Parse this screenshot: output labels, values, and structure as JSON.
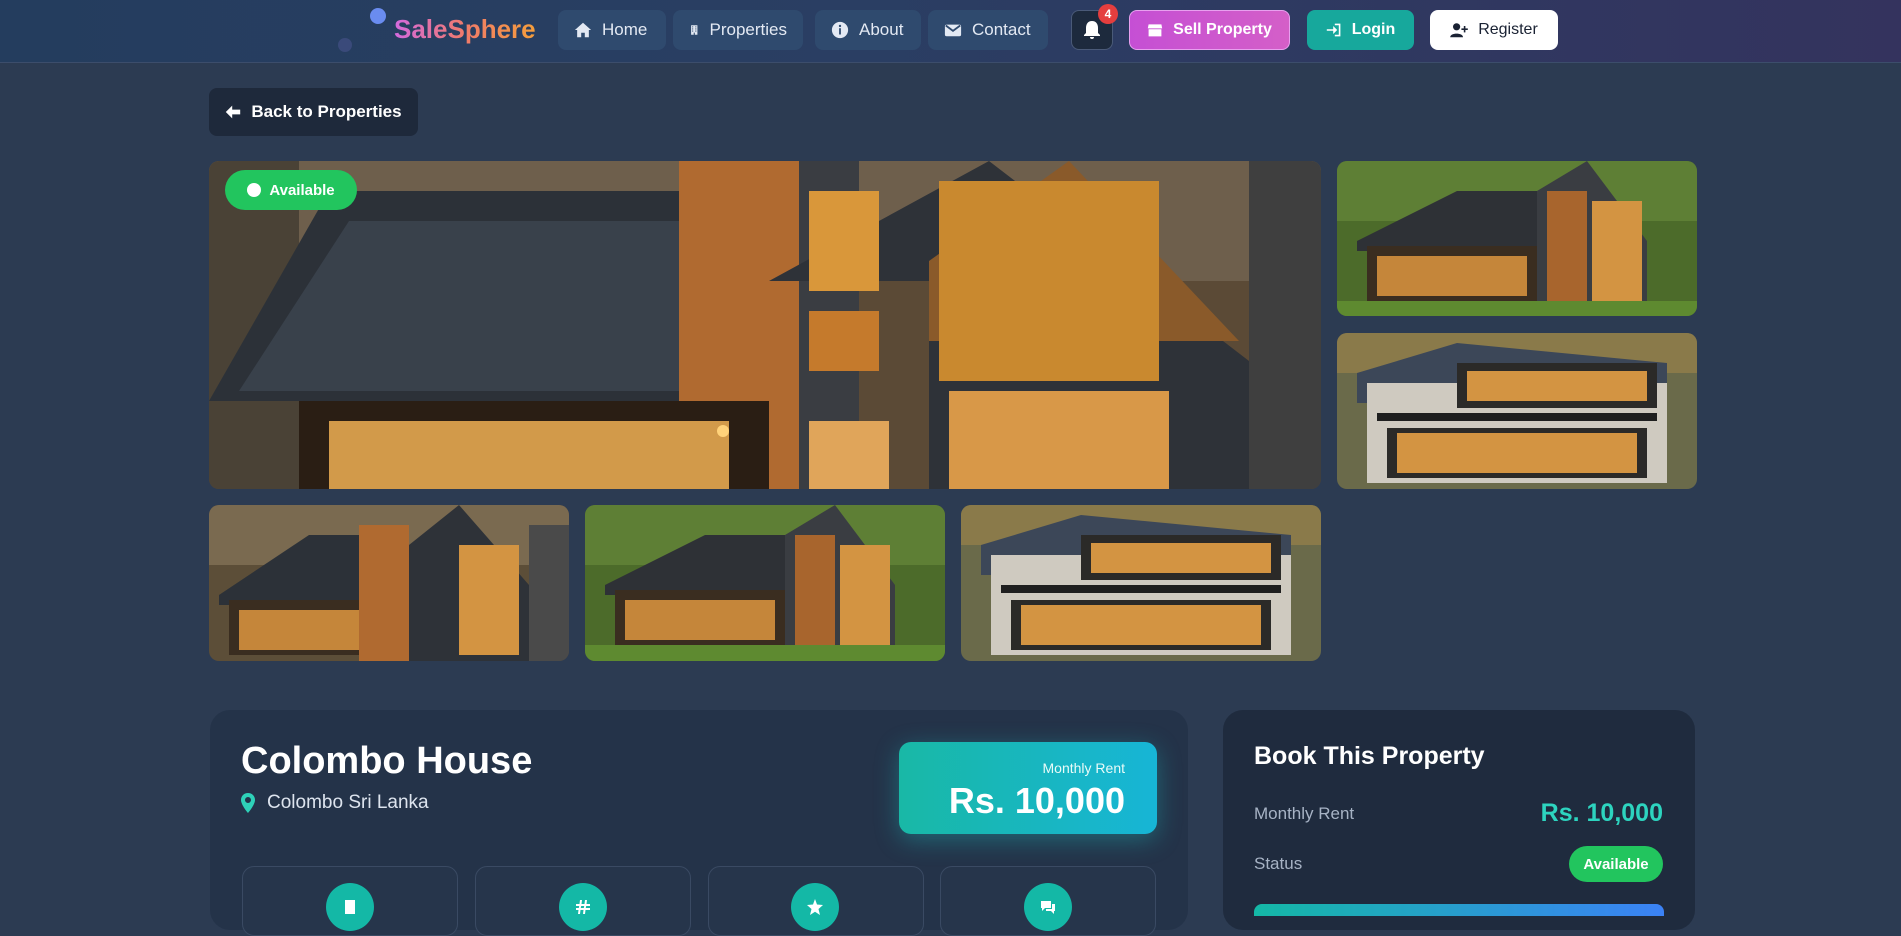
{
  "nav": {
    "brand": "SaleSphere",
    "links": [
      {
        "label": "Home",
        "icon": "home-icon"
      },
      {
        "label": "Properties",
        "icon": "building-icon"
      },
      {
        "label": "About",
        "icon": "info-icon"
      },
      {
        "label": "Contact",
        "icon": "envelope-icon"
      }
    ],
    "notification_count": "4",
    "sell_label": "Sell Property",
    "login_label": "Login",
    "register_label": "Register"
  },
  "back_label": "Back to Properties",
  "gallery": {
    "status_badge": "Available",
    "photos": [
      {
        "name": "main-photo",
        "style": "closeup"
      },
      {
        "name": "side-photo-1",
        "style": "wood"
      },
      {
        "name": "side-photo-2",
        "style": "stone"
      },
      {
        "name": "thumb-photo-1",
        "style": "autumn"
      },
      {
        "name": "thumb-photo-2",
        "style": "wood"
      },
      {
        "name": "thumb-photo-3",
        "style": "stone"
      }
    ]
  },
  "property": {
    "title": "Colombo House",
    "location": "Colombo Sri Lanka",
    "price_label": "Monthly Rent",
    "price": "Rs. 10,000",
    "feature_icons": [
      "building-icon",
      "hash-icon",
      "star-icon",
      "chat-icon"
    ]
  },
  "booking": {
    "title": "Book This Property",
    "rent_label": "Monthly Rent",
    "rent_value": "Rs. 10,000",
    "status_label": "Status",
    "status_value": "Available"
  },
  "colors": {
    "accent_teal": "#14b8a6",
    "available_green": "#22c55e",
    "sell_pink": "#c54fd4"
  }
}
